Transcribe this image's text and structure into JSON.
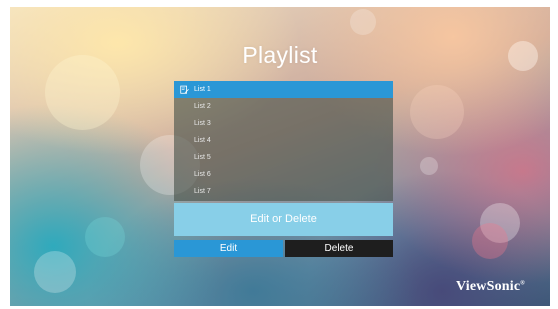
{
  "screen": {
    "title": "Playlist",
    "accent_color": "#2a97d6",
    "banner_color": "#88cfe8",
    "delete_color": "#1e1e1e"
  },
  "playlist": {
    "items": [
      {
        "label": "List 1",
        "selected": true,
        "icon": "edit-list-icon"
      },
      {
        "label": "List 2"
      },
      {
        "label": "List 3"
      },
      {
        "label": "List 4"
      },
      {
        "label": "List 5"
      },
      {
        "label": "List 6"
      },
      {
        "label": "List 7"
      }
    ]
  },
  "actions": {
    "banner_label": "Edit or Delete",
    "edit_label": "Edit",
    "delete_label": "Delete"
  },
  "brand": {
    "logo_text": "ViewSonic"
  }
}
